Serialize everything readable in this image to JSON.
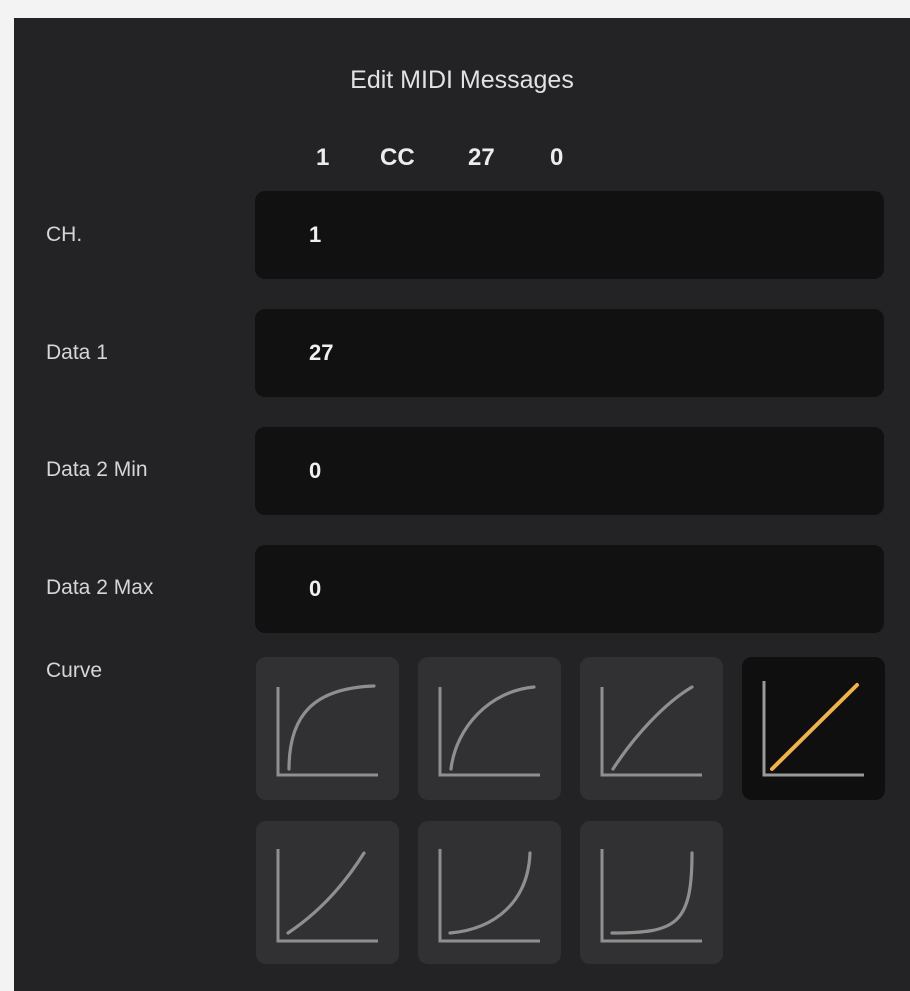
{
  "dialog": {
    "title": "Edit MIDI Messages",
    "summary": {
      "channel": "1",
      "type": "CC",
      "data1": "27",
      "data2": "0"
    }
  },
  "fields": [
    {
      "label": "CH.",
      "value": "1"
    },
    {
      "label": "Data 1",
      "value": "27"
    },
    {
      "label": "Data 2 Min",
      "value": "0"
    },
    {
      "label": "Data 2 Max",
      "value": "0"
    }
  ],
  "curve": {
    "label": "Curve",
    "selected_index": 3,
    "options": [
      {
        "icon": "curve-log-strong-icon"
      },
      {
        "icon": "curve-log-medium-icon"
      },
      {
        "icon": "curve-log-light-icon"
      },
      {
        "icon": "curve-linear-icon"
      },
      {
        "icon": "curve-exp-light-icon"
      },
      {
        "icon": "curve-exp-medium-icon"
      },
      {
        "icon": "curve-exp-strong-icon"
      }
    ]
  },
  "colors": {
    "panel_bg": "#232325",
    "field_bg": "#111112",
    "curve_button_bg": "#313133",
    "curve_line": "#8f8f8f",
    "curve_selected": "#f2b24a"
  }
}
